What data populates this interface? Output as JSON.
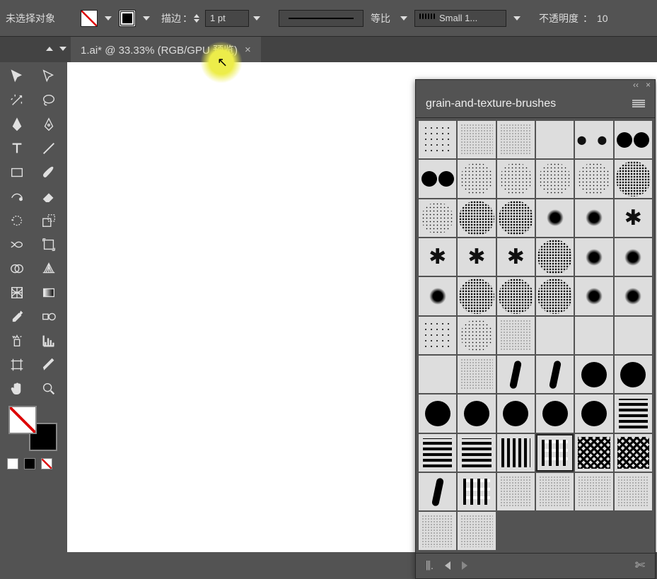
{
  "topbar": {
    "selection_status": "未选择对象",
    "stroke_label": "描边",
    "stroke_value": "1 pt",
    "profile_label": "等比",
    "brush_name": "Small 1...",
    "opacity_label": "不透明度",
    "opacity_value": "10"
  },
  "tab": {
    "title": "1.ai* @ 33.33% (RGB/GPU 预览)",
    "close": "×"
  },
  "panel": {
    "title": "grain-and-texture-brushes",
    "collapse": "‹‹",
    "close": "×"
  },
  "brushes": [
    "p-dots-sm",
    "p-noise",
    "p-noise",
    "p-empty",
    "p-dots-lg",
    "p-2circle",
    "p-2circle",
    "p-spray",
    "p-spray",
    "p-spray",
    "p-spray",
    "p-spray-d",
    "p-spray",
    "p-spray-d",
    "p-spray-d",
    "p-blob",
    "p-blob",
    "p-splat",
    "p-splat",
    "p-splat",
    "p-splat",
    "p-spray-d",
    "p-blob",
    "p-blob",
    "p-blob",
    "p-spray-d",
    "p-spray-d",
    "p-spray-d",
    "p-blob",
    "p-blob",
    "p-dots-sm",
    "p-spray",
    "p-noise",
    "p-empty",
    "p-empty",
    "p-empty",
    "p-empty",
    "p-noise",
    "p-bar",
    "p-bar",
    "p-circle",
    "p-circle",
    "p-circle",
    "p-circle",
    "p-circle",
    "p-circle",
    "p-circle",
    "p-hlines",
    "p-hlines",
    "p-hlines",
    "p-lines",
    "p-dash",
    "p-weave",
    "p-weave",
    "p-bar",
    "p-dash",
    "p-noise",
    "p-noise",
    "p-noise",
    "p-noise",
    "p-noise",
    "p-noise",
    "",
    "",
    "",
    ""
  ],
  "selected_brush_index": 51
}
